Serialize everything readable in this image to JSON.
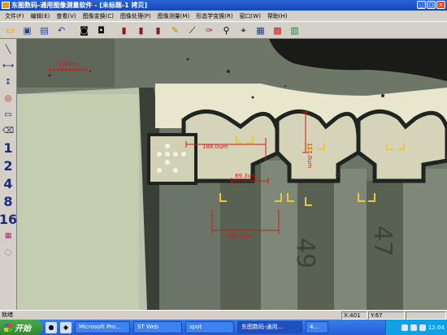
{
  "window": {
    "title": "东图数码-通用图像测量软件 - [未标题-1 拷贝]",
    "buttons": [
      "_",
      "□",
      "×"
    ]
  },
  "menu": [
    "文件(F)",
    "编辑(E)",
    "查看(V)",
    "图像变换(C)",
    "图像处理(P)",
    "图像测量(M)",
    "形态学变换(R)",
    "窗口(W)",
    "帮助(H)"
  ],
  "toolbar": [
    "new-file",
    "save",
    "open",
    "undo",
    "camera",
    "camera-capture",
    "histogram-1",
    "histogram-2",
    "histogram-3",
    "pencil",
    "ruler",
    "wand",
    "magnify",
    "pin",
    "grid",
    "compare",
    "calculator"
  ],
  "left_tools": {
    "icons": [
      "line",
      "horizontal-line",
      "vertical-line",
      "angle",
      "rect-select",
      "eraser"
    ],
    "numbers": [
      "1",
      "2",
      "4",
      "8",
      "16"
    ]
  },
  "measurements": {
    "scale": "100um",
    "m1": "188.0um",
    "m2": "89.3um",
    "m3": "157.7um",
    "m4": "117.0um"
  },
  "chip_labels": {
    "left": "49",
    "right": "47"
  },
  "status": {
    "text": "就绪",
    "x": "X:401",
    "y": "Y:67"
  },
  "taskbar": {
    "start": "开始",
    "tasks": [
      "Microsoft Pro...",
      "ST Web",
      "spot",
      "东图数码-通用...",
      "4..."
    ],
    "clock": "12:04"
  }
}
